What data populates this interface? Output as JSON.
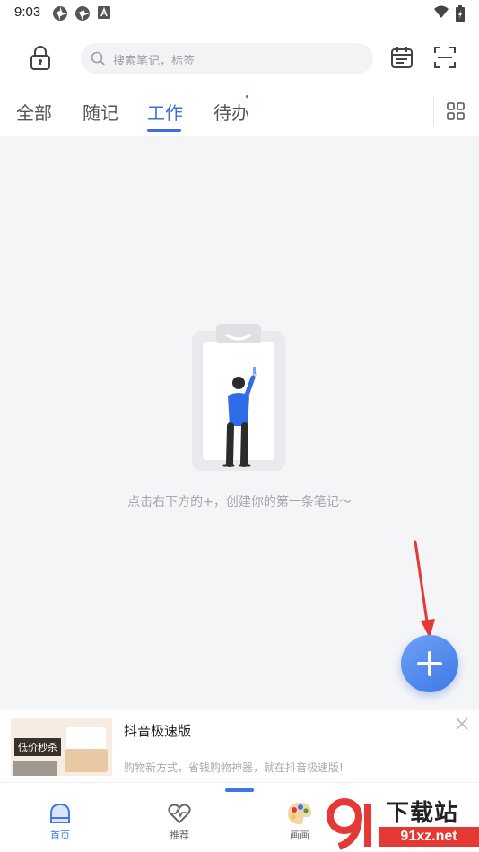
{
  "status_bar": {
    "time": "9:03",
    "icons": [
      "pinwheel-icon",
      "pinwheel-icon",
      "font-icon",
      "wifi-icon",
      "battery-icon"
    ]
  },
  "header": {
    "search_placeholder": "搜索笔记，标签",
    "icons": [
      "lock-icon",
      "search-icon",
      "calendar-icon",
      "scan-icon"
    ]
  },
  "tabs": [
    {
      "label": "全部",
      "active": false
    },
    {
      "label": "随记",
      "active": false
    },
    {
      "label": "工作",
      "active": true
    },
    {
      "label": "待办",
      "active": false
    }
  ],
  "empty_state": {
    "text": "点击右下方的+，创建你的第一条笔记～"
  },
  "fab": {
    "icon": "plus-icon"
  },
  "ad": {
    "image_tag": "低价秒杀",
    "title": "抖音极速版",
    "description": "购物新方式，省钱购物神器，就在抖音极速版!"
  },
  "bottom_nav": [
    {
      "label": "首页",
      "icon": "home-icon",
      "active": true
    },
    {
      "label": "推荐",
      "icon": "heart-pulse-icon",
      "active": false
    },
    {
      "label": "画画",
      "icon": "palette-icon",
      "active": false
    }
  ],
  "watermark": {
    "title": "下载站",
    "url": "91xz.net"
  },
  "colors": {
    "accent": "#3f78e6",
    "tab_active": "#3f6fdc",
    "content_bg": "#f4f5f7",
    "annotation_arrow": "#e53935"
  }
}
